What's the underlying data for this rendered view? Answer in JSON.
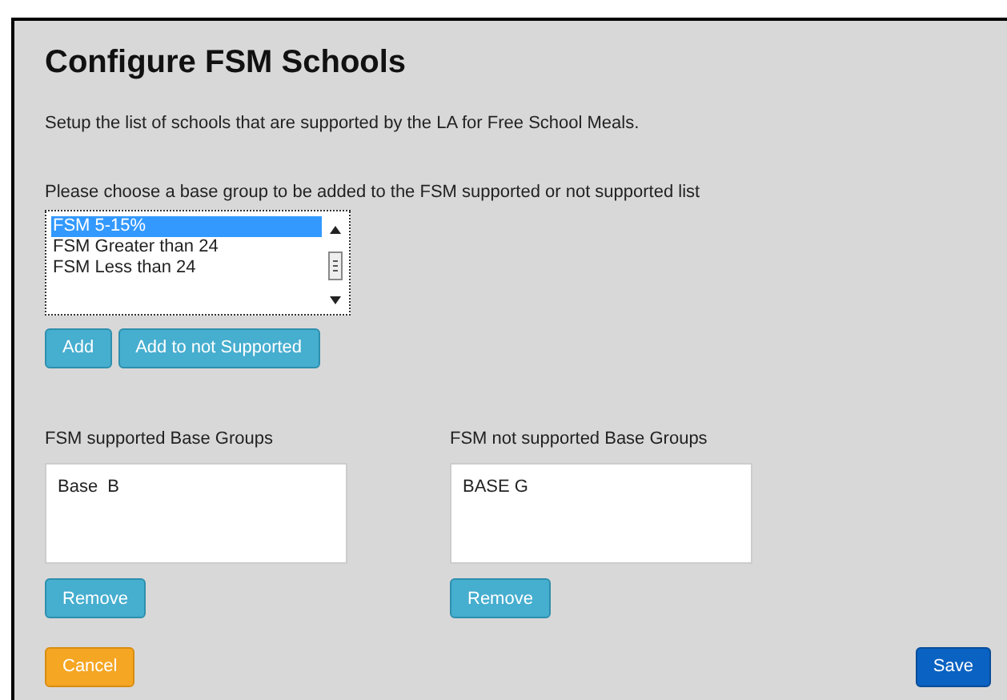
{
  "title": "Configure FSM Schools",
  "description": "Setup the list of schools that are supported by the LA for Free School Meals.",
  "prompt": "Please choose a base group to be added to the FSM supported or not supported list",
  "base_groups": [
    {
      "label": "FSM 5-15%",
      "selected": true
    },
    {
      "label": "FSM Greater than 24",
      "selected": false
    },
    {
      "label": "FSM Less than 24",
      "selected": false
    }
  ],
  "add_buttons": [
    {
      "label": "Add",
      "kind": "info"
    },
    {
      "label": "Add to not Supported",
      "kind": "info"
    }
  ],
  "lists": [
    {
      "heading": "FSM supported Base Groups",
      "items": [
        "Base  B"
      ],
      "button": "Remove"
    },
    {
      "heading": "FSM not supported Base Groups",
      "items": [
        "BASE G"
      ],
      "button": "Remove"
    }
  ],
  "footer": [
    {
      "label": "Cancel",
      "kind": "warning"
    },
    {
      "label": "Save",
      "kind": "primary"
    }
  ]
}
